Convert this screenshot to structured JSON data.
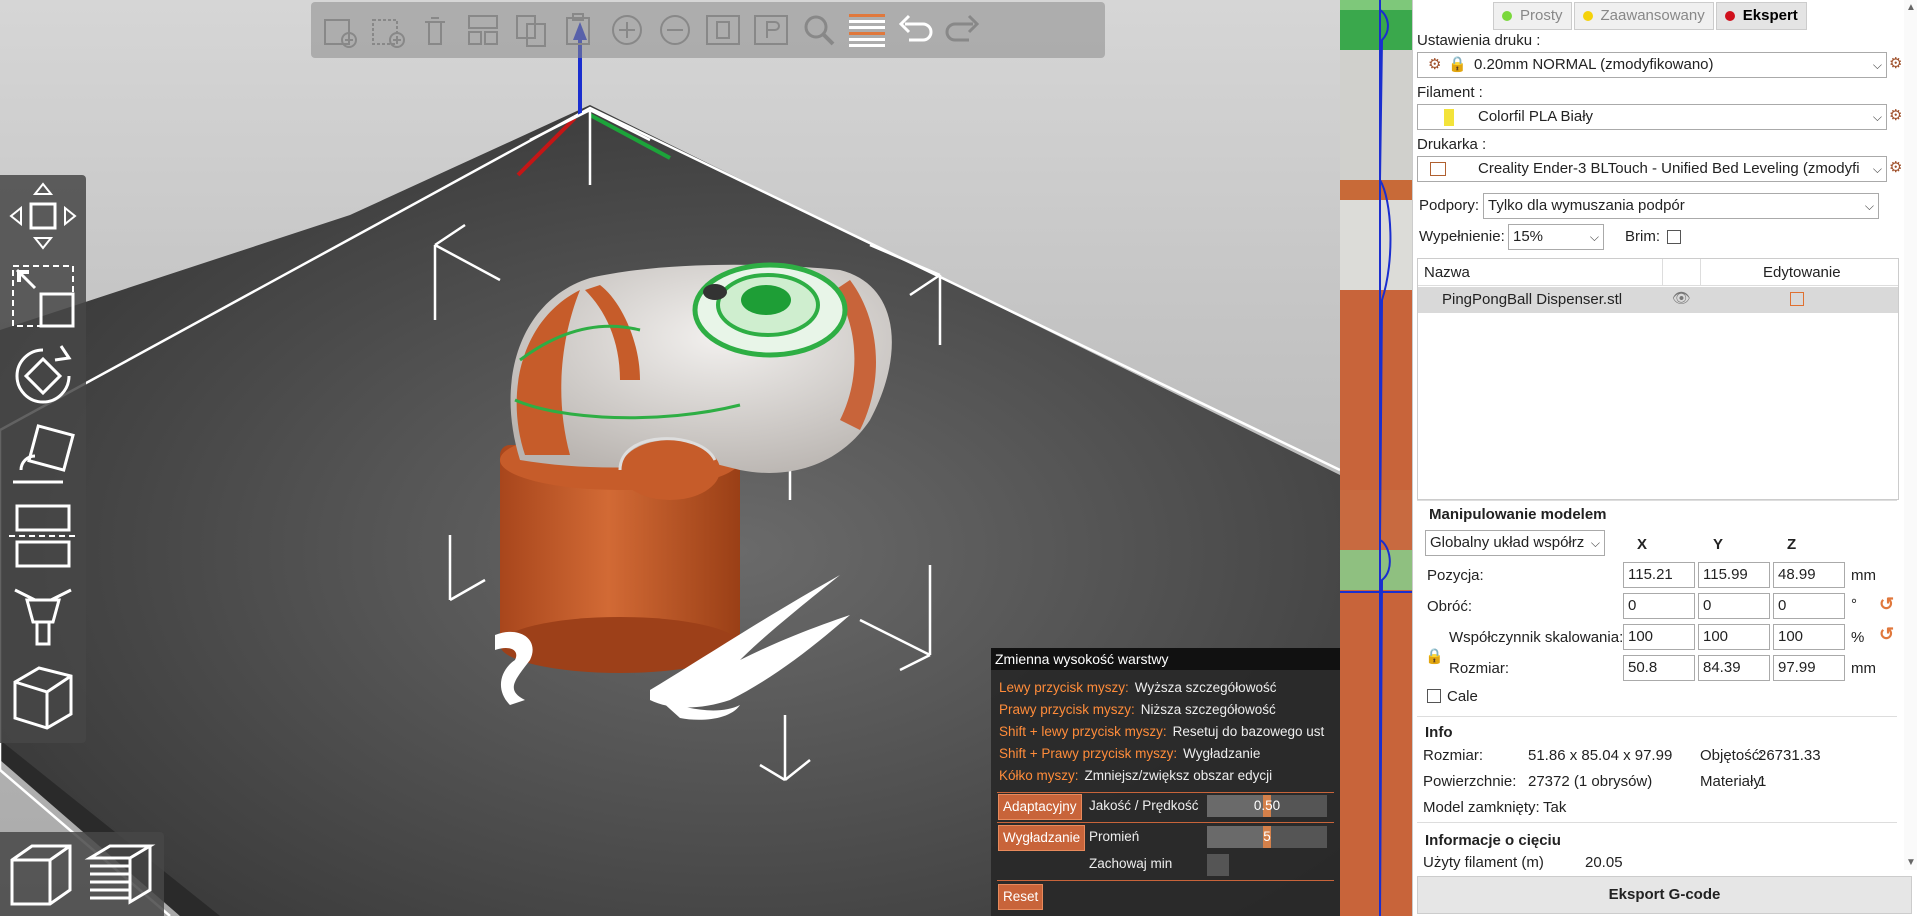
{
  "mode_tabs": [
    {
      "label": "Prosty",
      "color": "#7ad83c",
      "active": false
    },
    {
      "label": "Zaawansowany",
      "color": "#f5d20a",
      "active": false
    },
    {
      "label": "Ekspert",
      "color": "#d0101c",
      "active": true
    }
  ],
  "print_settings": {
    "label": "Ustawienia druku :",
    "value": "0.20mm NORMAL (zmodyfikowano)"
  },
  "filament": {
    "label": "Filament :",
    "value": "Colorfil PLA Biały",
    "color": "#f3e33a"
  },
  "printer": {
    "label": "Drukarka :",
    "value": "Creality Ender-3 BLTouch - Unified Bed Leveling (zmodyfi"
  },
  "supports": {
    "label": "Podpory:",
    "value": "Tylko dla wymuszania podpór"
  },
  "infill": {
    "label": "Wypełnienie:",
    "value": "15%"
  },
  "brim": {
    "label": "Brim:"
  },
  "object_list": {
    "col_name": "Nazwa",
    "col_edit": "Edytowanie",
    "rows": [
      {
        "name": "PingPongBall Dispenser.stl"
      }
    ]
  },
  "manipulation": {
    "title": "Manipulowanie modelem",
    "coord_system": "Globalny układ współrz",
    "axes": [
      "X",
      "Y",
      "Z"
    ],
    "position": {
      "label": "Pozycja:",
      "values": [
        "115.21",
        "115.99",
        "48.99"
      ],
      "unit": "mm"
    },
    "rotation": {
      "label": "Obróć:",
      "values": [
        "0",
        "0",
        "0"
      ],
      "unit": "°"
    },
    "scale": {
      "label": "Współczynnik skalowania:",
      "values": [
        "100",
        "100",
        "100"
      ],
      "unit": "%"
    },
    "size": {
      "label": "Rozmiar:",
      "values": [
        "50.8",
        "84.39",
        "97.99"
      ],
      "unit": "mm"
    },
    "inches_label": "Cale"
  },
  "info": {
    "title": "Info",
    "size_label": "Rozmiar:",
    "size_value": "51.86 x 85.04 x 97.99",
    "volume_label": "Objętość:",
    "volume_value": "26731.33",
    "surface_label": "Powierzchnie:",
    "surface_value": "27372 (1 obrysów)",
    "materials_label": "Materiały:",
    "materials_value": "1",
    "closed_label": "Model zamknięty:",
    "closed_value": "Tak"
  },
  "slice_info": {
    "title": "Informacje o cięciu",
    "filament_label": "Użyty filament (m)",
    "filament_value": "20.05"
  },
  "export_button": "Eksport G-code",
  "vlh": {
    "title": "Zmienna wysokość warstwy",
    "hints": [
      {
        "key": "Lewy przycisk myszy:",
        "value": "Wyższa szczegółowość"
      },
      {
        "key": "Prawy przycisk myszy:",
        "value": "Niższa szczegółowość"
      },
      {
        "key": "Shift + lewy przycisk myszy:",
        "value": "Resetuj do bazowego ust"
      },
      {
        "key": "Shift + Prawy przycisk myszy:",
        "value": "Wygładzanie"
      },
      {
        "key": "Kółko myszy:",
        "value": "Zmniejsz/zwiększ obszar edycji"
      }
    ],
    "adaptive_button": "Adaptacyjny",
    "quality_label": "Jakość / Prędkość",
    "quality_value": "0.50",
    "quality_level": 0.5,
    "smooth_button": "Wygładzanie",
    "radius_label": "Promień",
    "radius_value": "5",
    "radius_level": 0.5,
    "keep_min_label": "Zachowaj min",
    "reset_button": "Reset"
  },
  "colors": {
    "accent": "#c8643a",
    "model_orange": "#c65c2a",
    "model_white": "#e9e6e2",
    "layer_green": "#2eae44"
  }
}
